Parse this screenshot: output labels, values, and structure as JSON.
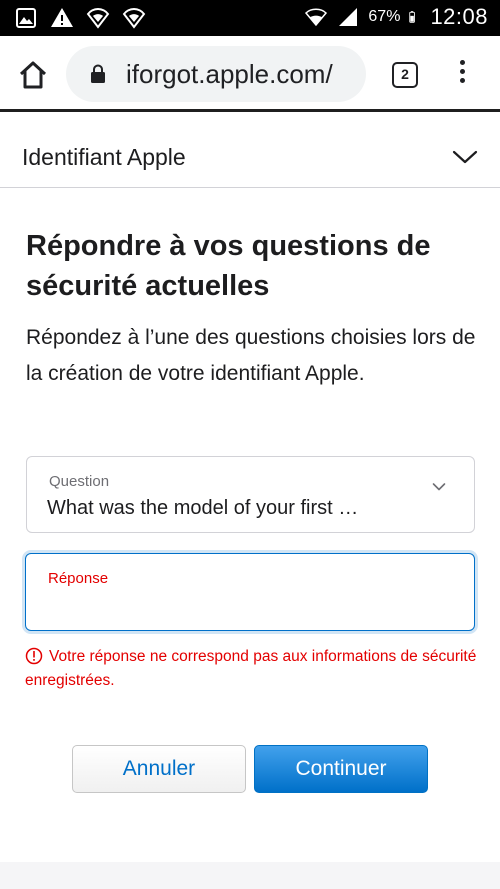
{
  "status_bar": {
    "battery_percent": "67%",
    "time": "12:08",
    "left_icons": [
      "image-icon",
      "warning-icon",
      "shield-wifi-icon",
      "shield-wifi-icon"
    ],
    "right_icons": [
      "wifi-icon",
      "signal-icon",
      "battery-icon"
    ]
  },
  "browser": {
    "url": "iforgot.apple.com/",
    "tab_count": "2"
  },
  "page_header": {
    "title": "Identifiant Apple"
  },
  "main": {
    "heading": "Répondre à vos questions de sécurité actuelles",
    "description": "Répondez à l’une des questions choisies lors de la création de votre identifiant Apple."
  },
  "question_field": {
    "label": "Question",
    "value": "What was the model of your first …"
  },
  "answer_field": {
    "label": "Réponse",
    "value": ""
  },
  "error": {
    "message": "Votre réponse ne correspond pas aux informations de sécurité enregistrées.",
    "color": "#e30000"
  },
  "buttons": {
    "cancel_label": "Annuler",
    "continue_label": "Continuer"
  },
  "colors": {
    "accent": "#0070c9",
    "error": "#e30000"
  }
}
